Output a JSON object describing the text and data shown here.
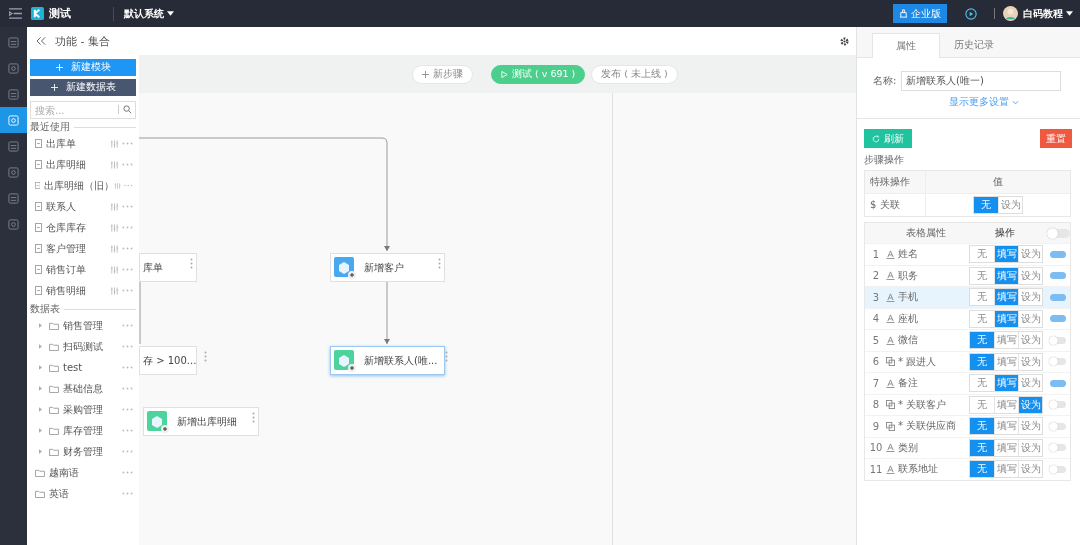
{
  "topbar": {
    "app_name": "测试",
    "system": "默认系统",
    "edition_button": "企业版",
    "user": "白码教程"
  },
  "nav_rail": [
    {
      "selected": false
    },
    {
      "selected": false
    },
    {
      "selected": false
    },
    {
      "selected": true
    },
    {
      "selected": false
    },
    {
      "selected": false
    },
    {
      "selected": false
    },
    {
      "selected": false
    }
  ],
  "header": {
    "title": "功能 - 集合"
  },
  "toolbar": {
    "new_step": "新步骤",
    "test": "测试 ( v 691 )",
    "publish": "发布 ( 未上线 )"
  },
  "module_panel": {
    "new_module": "新建模块",
    "new_table": "新建数据表",
    "search": {
      "placeholder": "搜索..."
    },
    "recent_title": "最近使用",
    "recent": [
      "出库单",
      "出库明细",
      "出库明细（旧）",
      "联系人",
      "仓库库存",
      "客户管理",
      "销售订单",
      "销售明细"
    ],
    "tables_title": "数据表",
    "folders": [
      {
        "name": "销售管理",
        "expandable": true
      },
      {
        "name": "扫码测试",
        "expandable": true
      },
      {
        "name": "test",
        "expandable": true
      },
      {
        "name": "基础信息",
        "expandable": true
      },
      {
        "name": "采购管理",
        "expandable": true
      },
      {
        "name": "库存管理",
        "expandable": true
      },
      {
        "name": "财务管理",
        "expandable": true
      },
      {
        "name": "越南语",
        "expandable": false
      },
      {
        "name": "英语",
        "expandable": false
      }
    ]
  },
  "canvas": {
    "nodes": [
      {
        "kind": "cut",
        "label": "库单",
        "selected": false
      },
      {
        "kind": "step",
        "label": "新增客户",
        "color": "#4aa8f0",
        "selected": false
      },
      {
        "kind": "cut",
        "label": "存 > 100...",
        "selected": false
      },
      {
        "kind": "step",
        "label": "新增联系人(唯...",
        "color": "#4dd39b",
        "selected": true
      },
      {
        "kind": "step",
        "label": "新增出库明细",
        "color": "#4dd39b",
        "selected": false
      }
    ]
  },
  "properties": {
    "tabs": [
      {
        "label": "属性",
        "selected": true
      },
      {
        "label": "历史记录",
        "selected": false
      }
    ],
    "name_label": "名称:",
    "name_value": "新增联系人(唯一)",
    "more_settings": "显示更多设置",
    "refresh": "刷新",
    "reset": "重置",
    "step_ops_title": "步骤操作",
    "special_table": {
      "columns": [
        "特殊操作",
        "值"
      ],
      "rows": [
        {
          "name": "$ 关联",
          "options": [
            {
              "label": "无",
              "selected": true
            },
            {
              "label": "设为",
              "selected": false
            }
          ]
        }
      ]
    },
    "field_table": {
      "columns": [
        "表格属性",
        "操作"
      ],
      "toggle_on": false,
      "rows": [
        {
          "number": "1",
          "kind": "text",
          "name": "姓名",
          "selected": false,
          "options": [
            {
              "label": "无",
              "selected": false
            },
            {
              "label": "填写",
              "selected": true
            },
            {
              "label": "设为",
              "selected": false
            }
          ],
          "on": true
        },
        {
          "number": "2",
          "kind": "text",
          "name": "职务",
          "selected": false,
          "options": [
            {
              "label": "无",
              "selected": false
            },
            {
              "label": "填写",
              "selected": true
            },
            {
              "label": "设为",
              "selected": false
            }
          ],
          "on": true
        },
        {
          "number": "3",
          "kind": "text",
          "name": "手机",
          "selected": true,
          "options": [
            {
              "label": "无",
              "selected": false
            },
            {
              "label": "填写",
              "selected": true
            },
            {
              "label": "设为",
              "selected": false
            }
          ],
          "on": true
        },
        {
          "number": "4",
          "kind": "text",
          "name": "座机",
          "selected": false,
          "options": [
            {
              "label": "无",
              "selected": false
            },
            {
              "label": "填写",
              "selected": true
            },
            {
              "label": "设为",
              "selected": false
            }
          ],
          "on": true
        },
        {
          "number": "5",
          "kind": "text",
          "name": "微信",
          "selected": false,
          "options": [
            {
              "label": "无",
              "selected": true
            },
            {
              "label": "填写",
              "selected": false
            },
            {
              "label": "设为",
              "selected": false
            }
          ],
          "on": false
        },
        {
          "number": "6",
          "kind": "link",
          "name": "* 跟进人",
          "selected": false,
          "options": [
            {
              "label": "无",
              "selected": true
            },
            {
              "label": "填写",
              "selected": false
            },
            {
              "label": "设为",
              "selected": false
            }
          ],
          "on": false
        },
        {
          "number": "7",
          "kind": "text",
          "name": "备注",
          "selected": false,
          "options": [
            {
              "label": "无",
              "selected": false
            },
            {
              "label": "填写",
              "selected": true
            },
            {
              "label": "设为",
              "selected": false
            }
          ],
          "on": true
        },
        {
          "number": "8",
          "kind": "link",
          "name": "* 关联客户",
          "selected": false,
          "options": [
            {
              "label": "无",
              "selected": false
            },
            {
              "label": "填写",
              "selected": false
            },
            {
              "label": "设为",
              "selected": true
            }
          ],
          "on": false
        },
        {
          "number": "9",
          "kind": "link",
          "name": "* 关联供应商",
          "selected": false,
          "options": [
            {
              "label": "无",
              "selected": true
            },
            {
              "label": "填写",
              "selected": false
            },
            {
              "label": "设为",
              "selected": false
            }
          ],
          "on": false
        },
        {
          "number": "10",
          "kind": "text",
          "name": "类别",
          "selected": false,
          "options": [
            {
              "label": "无",
              "selected": true
            },
            {
              "label": "填写",
              "selected": false
            },
            {
              "label": "设为",
              "selected": false
            }
          ],
          "on": false
        },
        {
          "number": "11",
          "kind": "text",
          "name": "联系地址",
          "selected": false,
          "options": [
            {
              "label": "无",
              "selected": true
            },
            {
              "label": "填写",
              "selected": false
            },
            {
              "label": "设为",
              "selected": false
            }
          ],
          "on": false
        }
      ]
    }
  }
}
